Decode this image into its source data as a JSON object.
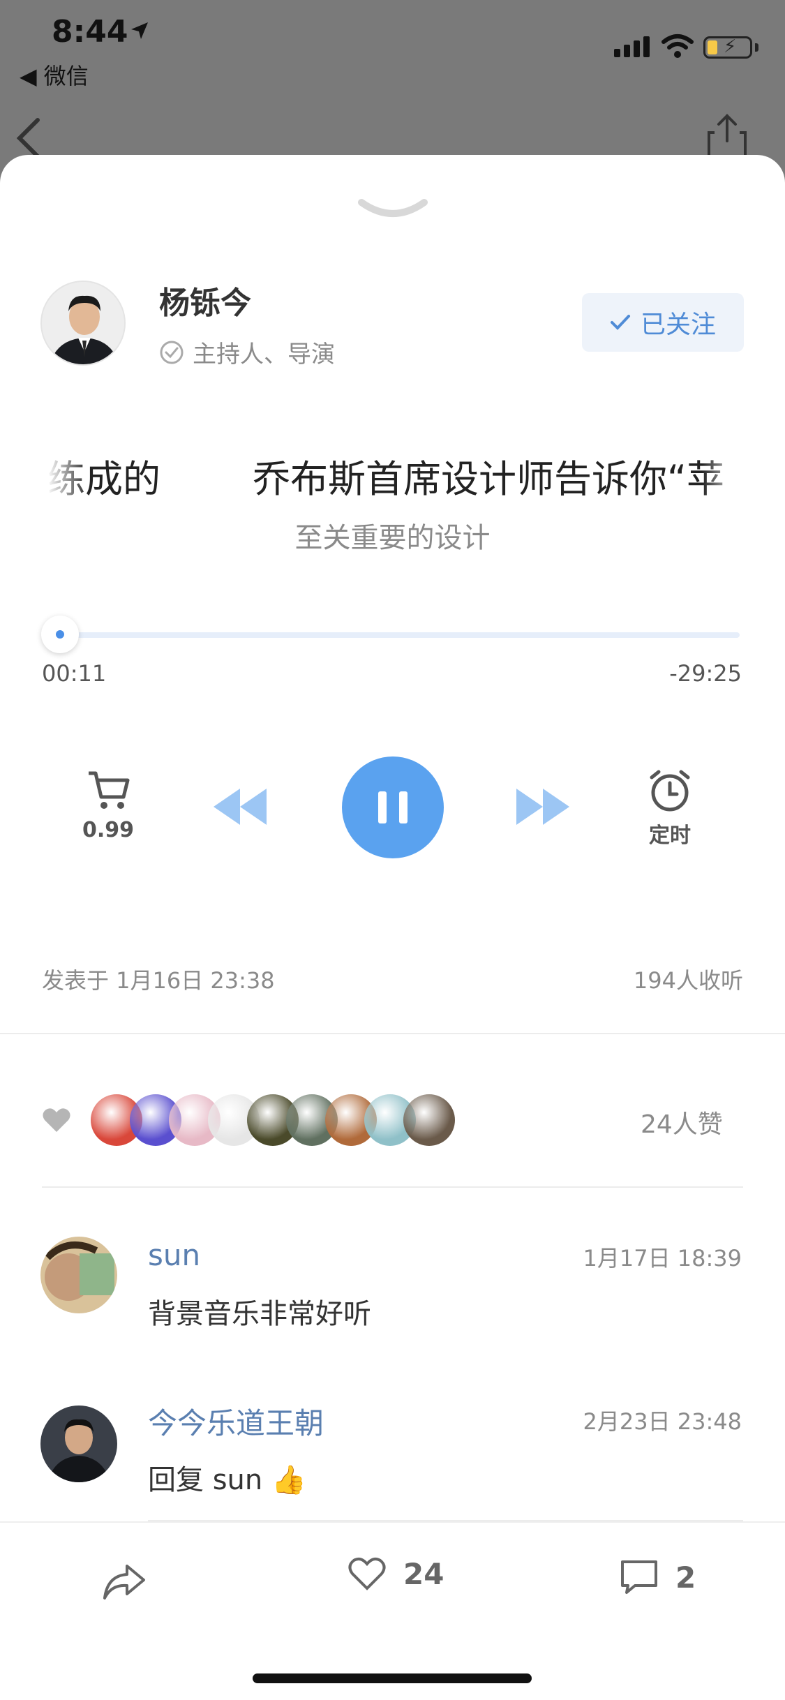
{
  "status_bar": {
    "time": "8:44",
    "back_app": "◀ 微信"
  },
  "host": {
    "name": "杨铄今",
    "role": "主持人、导演",
    "follow_label": "已关注"
  },
  "episode": {
    "title_left": "练成的",
    "title_right": "乔布斯首席设计师告诉你“苹",
    "subtitle": "至关重要的设计",
    "progress_fraction": 0.006
  },
  "player": {
    "elapsed": "00:11",
    "remaining": "-29:25",
    "price_label": "0.99",
    "timer_label": "定时"
  },
  "meta": {
    "published": "发表于 1月16日 23:38",
    "listeners": "194人收听"
  },
  "likes": {
    "count_label": "24人赞",
    "liker_colors": [
      "#d9473a",
      "#5a4fcf",
      "#e7b9c6",
      "#e6e6e6",
      "#4a4a2a",
      "#607060",
      "#b06a3a",
      "#8fc0c8",
      "#6a5a4a"
    ]
  },
  "comments": [
    {
      "name": "sun",
      "time": "1月17日 18:39",
      "text": "背景音乐非常好听",
      "avatar_color": "#c9a37c"
    },
    {
      "name": "今今乐道王朝",
      "time": "2月23日 23:48",
      "text": "回复 sun 👍",
      "avatar_color": "#2c2f36"
    }
  ],
  "bottom_bar": {
    "like_count": "24",
    "comment_count": "2"
  },
  "colors": {
    "accent": "#4a8fe7",
    "play_button": "#5aa2ef",
    "link_name": "#5a7fb0"
  }
}
